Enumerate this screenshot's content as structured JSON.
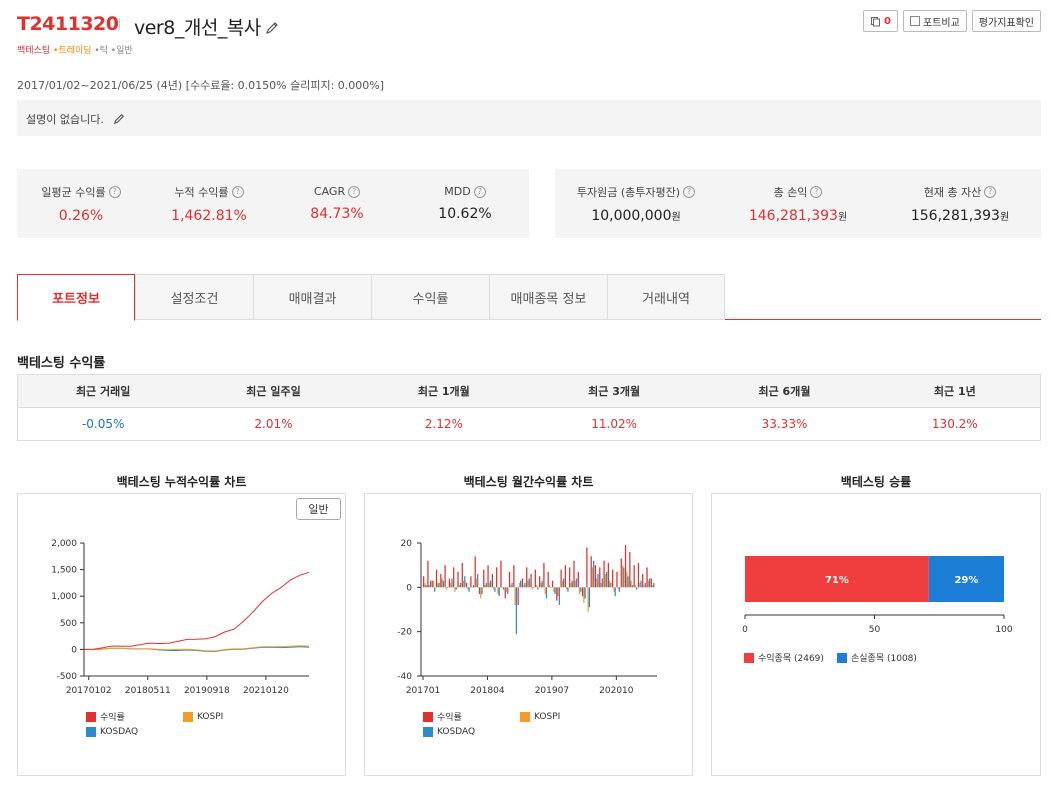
{
  "header": {
    "code": "T2411320",
    "name": "ver8_개선_복사",
    "tags": [
      "백테스팅",
      "트레이딩",
      "틱",
      "일반"
    ],
    "buttons": {
      "copy_count": "0",
      "compare": "포트비교",
      "eval": "평가지표확인"
    }
  },
  "period": "2017/01/02~2021/06/25 (4년) [수수료율: 0.0150% 슬리피지: 0.000%]",
  "description": "설명이 없습니다.",
  "stats_left": [
    {
      "label": "일평균 수익률",
      "value": "0.26%",
      "color": "#e03131"
    },
    {
      "label": "누적 수익률",
      "value": "1,462.81%",
      "color": "#e03131"
    },
    {
      "label": "CAGR",
      "value": "84.73%",
      "color": "#e03131"
    },
    {
      "label": "MDD",
      "value": "10.62%",
      "color": "#222222"
    }
  ],
  "stats_right": [
    {
      "label": "투자원금 (총투자평잔)",
      "value": "10,000,000",
      "unit": "원",
      "color": "#222222"
    },
    {
      "label": "총 손익",
      "value": "146,281,393",
      "unit": "원",
      "color": "#e03131"
    },
    {
      "label": "현재 총 자산",
      "value": "156,281,393",
      "unit": "원",
      "color": "#222222"
    }
  ],
  "tabs": [
    "포트정보",
    "설정조건",
    "매매결과",
    "수익률",
    "매매종목 정보",
    "거래내역"
  ],
  "active_tab": 0,
  "returns_title": "백테스팅 수익률",
  "returns": {
    "headers": [
      "최근 거래일",
      "최근 일주일",
      "최근 1개월",
      "최근 3개월",
      "최근 6개월",
      "최근 1년"
    ],
    "values": [
      "-0.05%",
      "2.01%",
      "2.12%",
      "11.02%",
      "33.33%",
      "130.2%"
    ]
  },
  "colors": {
    "red": "#e03131",
    "orange": "#f39c2b",
    "blue": "#1e88e5",
    "tealblue": "#2b8bcb"
  },
  "charts": {
    "cumulative": {
      "title": "백테스팅 누적수익률 차트",
      "toggle": "일반"
    },
    "monthly": {
      "title": "백테스팅 월간수익률 차트"
    },
    "winrate": {
      "title": "백테스팅 승률"
    }
  },
  "chart_data": [
    {
      "type": "line",
      "title": "백테스팅 누적수익률 차트",
      "xticks": [
        "20170102",
        "20180511",
        "20190918",
        "20210120"
      ],
      "yticks": [
        "2,000",
        "1,500",
        "1,000",
        "500",
        "0",
        "-500"
      ],
      "ylim": [
        -500,
        2000
      ],
      "x": [
        "2017-01",
        "2017-07",
        "2018-01",
        "2018-07",
        "2019-01",
        "2019-07",
        "2020-01",
        "2020-04",
        "2020-07",
        "2020-10",
        "2021-01",
        "2021-03",
        "2021-06"
      ],
      "series": [
        {
          "name": "수익률",
          "color": "#e03131",
          "values": [
            0,
            30,
            60,
            90,
            110,
            150,
            190,
            240,
            380,
            700,
            1050,
            1300,
            1450
          ]
        },
        {
          "name": "KOSPI",
          "color": "#f39c2b",
          "values": [
            0,
            10,
            20,
            10,
            0,
            0,
            -10,
            -30,
            10,
            30,
            50,
            60,
            60
          ]
        },
        {
          "name": "KOSDAQ",
          "color": "#2b8bcb",
          "values": [
            0,
            5,
            20,
            10,
            -10,
            -20,
            -20,
            -40,
            0,
            20,
            40,
            40,
            40
          ]
        }
      ]
    },
    {
      "type": "bar",
      "title": "백테스팅 월간수익률 차트",
      "xticks": [
        "201701",
        "201804",
        "201907",
        "202010"
      ],
      "yticks": [
        "20",
        "0",
        "-20",
        "-40"
      ],
      "ylim": [
        -40,
        20
      ],
      "categories": [
        "201701",
        "201702",
        "201703",
        "201704",
        "201705",
        "201706",
        "201707",
        "201708",
        "201709",
        "201710",
        "201711",
        "201712",
        "201801",
        "201802",
        "201803",
        "201804",
        "201805",
        "201806",
        "201807",
        "201808",
        "201809",
        "201810",
        "201811",
        "201812",
        "201901",
        "201902",
        "201903",
        "201904",
        "201905",
        "201906",
        "201907",
        "201908",
        "201909",
        "201910",
        "201911",
        "201912",
        "202001",
        "202002",
        "202003",
        "202004",
        "202005",
        "202006",
        "202007",
        "202008",
        "202009",
        "202010",
        "202011",
        "202012",
        "202101",
        "202102",
        "202103",
        "202104",
        "202105",
        "202106"
      ],
      "series": [
        {
          "name": "수익률",
          "color": "#e03131",
          "values": [
            5,
            12,
            3,
            8,
            6,
            10,
            4,
            9,
            7,
            11,
            2,
            5,
            14,
            -3,
            8,
            10,
            6,
            9,
            12,
            -5,
            7,
            10,
            -8,
            4,
            9,
            6,
            8,
            5,
            11,
            7,
            3,
            -6,
            8,
            10,
            9,
            12,
            7,
            -4,
            18,
            14,
            10,
            9,
            12,
            11,
            8,
            7,
            13,
            19,
            16,
            10,
            11,
            6,
            9,
            4
          ]
        },
        {
          "name": "KOSPI",
          "color": "#f39c2b",
          "values": [
            2,
            1,
            3,
            2,
            4,
            -1,
            2,
            -2,
            1,
            3,
            -1,
            0,
            4,
            -5,
            1,
            2,
            -1,
            -3,
            0,
            -2,
            1,
            -8,
            2,
            1,
            3,
            -1,
            1,
            2,
            -3,
            1,
            -2,
            -4,
            3,
            -1,
            2,
            3,
            -3,
            -7,
            -11,
            9,
            4,
            2,
            6,
            3,
            -2,
            -1,
            10,
            7,
            3,
            1,
            2,
            1,
            3,
            1
          ]
        },
        {
          "name": "KOSDAQ",
          "color": "#2b8bcb",
          "values": [
            1,
            3,
            -2,
            2,
            3,
            0,
            4,
            -1,
            2,
            5,
            -2,
            1,
            6,
            -3,
            2,
            3,
            -2,
            -4,
            -1,
            -3,
            2,
            -21,
            3,
            2,
            4,
            0,
            -1,
            3,
            -5,
            0,
            -3,
            -8,
            4,
            -2,
            3,
            4,
            -2,
            -5,
            -9,
            12,
            6,
            4,
            7,
            2,
            -4,
            -2,
            9,
            5,
            1,
            -1,
            3,
            2,
            4,
            2
          ]
        }
      ]
    },
    {
      "type": "bar",
      "orientation": "horizontal-stacked",
      "title": "백테스팅 승률",
      "xticks": [
        "0",
        "50",
        "100"
      ],
      "xlim": [
        0,
        100
      ],
      "series": [
        {
          "name": "수익종목 (2469)",
          "color": "#f03e3e",
          "value": 71,
          "label": "71%"
        },
        {
          "name": "손실종목 (1008)",
          "color": "#1c7ed6",
          "value": 29,
          "label": "29%"
        }
      ]
    }
  ]
}
